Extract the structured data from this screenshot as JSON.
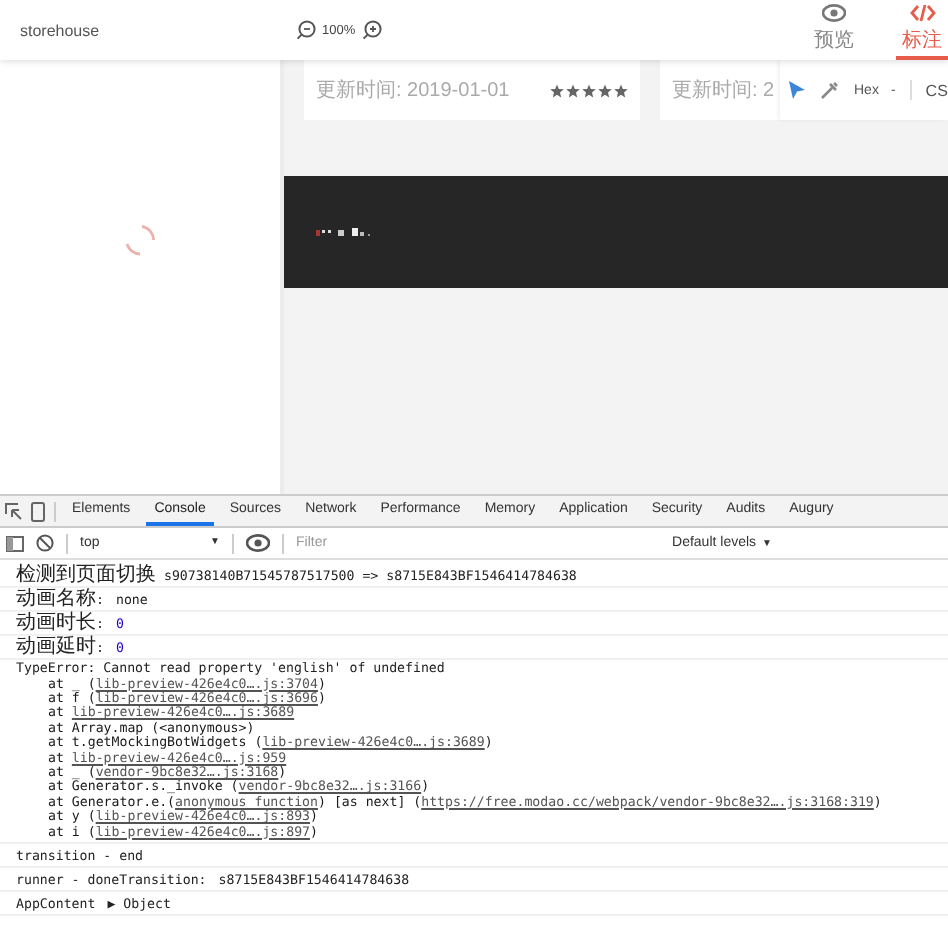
{
  "app": {
    "title": "storehouse",
    "zoom": "100%",
    "modes": [
      {
        "label": "预览",
        "selected": false
      },
      {
        "label": "标注",
        "selected": true
      }
    ]
  },
  "sidebar": {
    "loading": true
  },
  "cards": [
    {
      "updated": "更新时间: 2019-01-01",
      "stars": 5
    },
    {
      "updated": "更新时间: 2"
    }
  ],
  "inspect_toolbar": {
    "tools": [
      {
        "selected": true
      },
      {
        "selected": false
      }
    ],
    "format": "Hex",
    "format_caret": "-",
    "code_tab": "CS"
  },
  "devtools": {
    "tabs": [
      {
        "label": "Elements",
        "selected": false
      },
      {
        "label": "Console",
        "selected": true
      },
      {
        "label": "Sources",
        "selected": false
      },
      {
        "label": "Network",
        "selected": false
      },
      {
        "label": "Performance",
        "selected": false
      },
      {
        "label": "Memory",
        "selected": false
      },
      {
        "label": "Application",
        "selected": false
      },
      {
        "label": "Security",
        "selected": false
      },
      {
        "label": "Audits",
        "selected": false
      },
      {
        "label": "Augury",
        "selected": false
      }
    ],
    "context": "top",
    "context_caret": "▼",
    "filter": {
      "placeholder": "Filter"
    },
    "levels": "Default levels",
    "levels_caret": "▼"
  },
  "console": [
    {
      "kind": "log",
      "text": "检测到页面切换 s90738140B71545787517500 => s8715E843BF1546414784638"
    },
    {
      "kind": "pair",
      "label": "动画名称:",
      "value": "none",
      "numeric": false
    },
    {
      "kind": "pair",
      "label": "动画时长:",
      "value": "0",
      "numeric": true
    },
    {
      "kind": "pair",
      "label": "动画延时:",
      "value": "0",
      "numeric": true
    },
    {
      "kind": "trace",
      "message": "TypeError: Cannot read property 'english' of undefined",
      "stack": [
        [
          {
            "text": "at _ (",
            "link": false
          },
          {
            "text": "lib-preview-426e4c0….js:3704",
            "link": true
          },
          {
            "text": ")",
            "link": false
          }
        ],
        [
          {
            "text": "at f (",
            "link": false
          },
          {
            "text": "lib-preview-426e4c0….js:3696",
            "link": true
          },
          {
            "text": ")",
            "link": false
          }
        ],
        [
          {
            "text": "at ",
            "link": false
          },
          {
            "text": "lib-preview-426e4c0….js:3689",
            "link": true
          }
        ],
        [
          {
            "text": "at Array.map (<anonymous>)",
            "link": false
          }
        ],
        [
          {
            "text": "at t.getMockingBotWidgets (",
            "link": false
          },
          {
            "text": "lib-preview-426e4c0….js:3689",
            "link": true
          },
          {
            "text": ")",
            "link": false
          }
        ],
        [
          {
            "text": "at ",
            "link": false
          },
          {
            "text": "lib-preview-426e4c0….js:959",
            "link": true
          }
        ],
        [
          {
            "text": "at _ (",
            "link": false
          },
          {
            "text": "vendor-9bc8e32….js:3168",
            "link": true
          },
          {
            "text": ")",
            "link": false
          }
        ],
        [
          {
            "text": "at Generator.s._invoke (",
            "link": false
          },
          {
            "text": "vendor-9bc8e32….js:3166",
            "link": true
          },
          {
            "text": ")",
            "link": false
          }
        ],
        [
          {
            "text": "at Generator.e.(",
            "link": false
          },
          {
            "text": "anonymous function",
            "link": true
          },
          {
            "text": ") [as next] (",
            "link": false
          },
          {
            "text": "https://free.modao.cc/webpack/vendor-9bc8e32….js:3168:319",
            "link": true
          },
          {
            "text": ")",
            "link": false
          }
        ],
        [
          {
            "text": "at y (",
            "link": false
          },
          {
            "text": "lib-preview-426e4c0….js:893",
            "link": true
          },
          {
            "text": ")",
            "link": false
          }
        ],
        [
          {
            "text": "at i (",
            "link": false
          },
          {
            "text": "lib-preview-426e4c0….js:897",
            "link": true
          },
          {
            "text": ")",
            "link": false
          }
        ]
      ]
    },
    {
      "kind": "log",
      "text": "transition - end"
    },
    {
      "kind": "pair",
      "label": "runner - doneTransition:",
      "value": "s8715E843BF1546414784638",
      "numeric": false
    },
    {
      "kind": "object",
      "label": "AppContent",
      "toggle": "▶",
      "value": "Object"
    }
  ]
}
